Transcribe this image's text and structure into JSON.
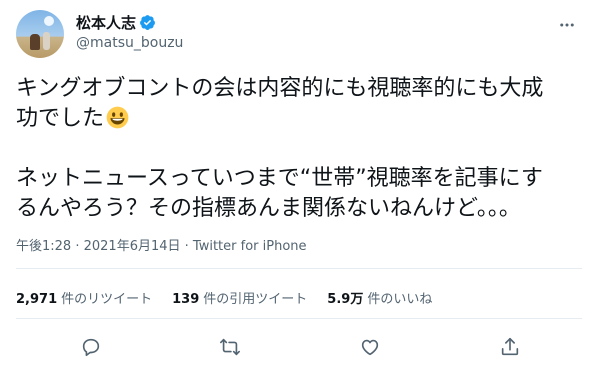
{
  "author": {
    "display_name": "松本人志",
    "handle": "@matsu_bouzu",
    "verified": true
  },
  "tweet": {
    "line1": "キングオブコントの会は内容的にも視聴率的にも大成",
    "line2": "功でした",
    "line2_emoji": "smiling-face-emoji",
    "line3": "ネットニュースっていつまで“世帯”視聴率を記事にす",
    "line4": "るんやろう？その指標あんま関係ないねんけど。。。"
  },
  "meta": {
    "time": "午後1:28",
    "separator": " · ",
    "date": "2021年6月14日",
    "source": "Twitter for iPhone"
  },
  "stats": {
    "retweets_count": "2,971",
    "retweets_label": "件のリツイート",
    "quotes_count": "139",
    "quotes_label": "件の引用ツイート",
    "likes_count": "5.9万",
    "likes_label": "件のいいね"
  },
  "colors": {
    "text": "#0f1419",
    "secondary": "#536471",
    "verified": "#1d9bf0",
    "divider": "#e6ecf0"
  },
  "icons": [
    "more-icon",
    "verified-icon",
    "reply-icon",
    "retweet-icon",
    "like-icon",
    "share-icon"
  ]
}
